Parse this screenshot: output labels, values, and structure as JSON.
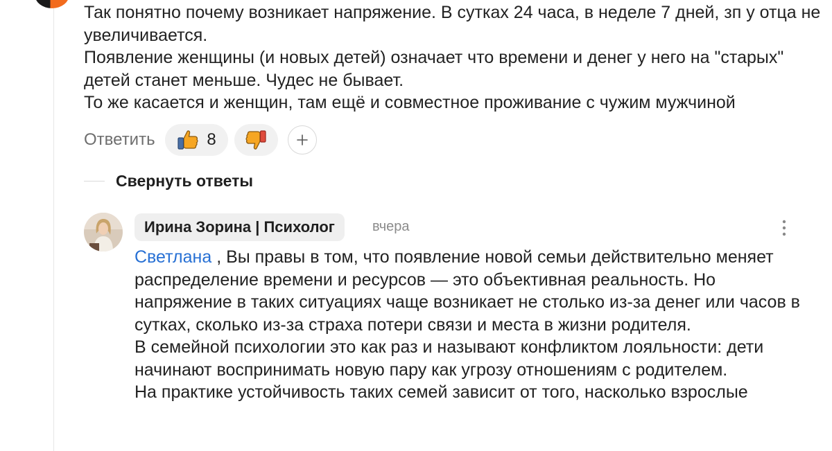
{
  "parent_comment": {
    "lines": [
      "Так понятно почему возникает напряжение. В сутках 24 часа, в неделе 7 дней, зп у отца не увеличивается.",
      "Появление женщины (и новых детей) означает что времени и денег у него на \"старых\" детей станет меньше. Чудес не бывает.",
      "То же касается и женщин, там ещё и совместное проживание с чужим мужчиной"
    ],
    "actions": {
      "reply_label": "Ответить",
      "like_count": "8",
      "like_icon": "thumbs-up-emoji",
      "dislike_icon": "thumbs-down-emoji",
      "plus_label": "+"
    }
  },
  "collapse_replies_label": "Свернуть ответы",
  "reply": {
    "author": "Ирина Зорина | Психолог",
    "timestamp": "вчера",
    "mention": "Светлана",
    "paragraphs": [
      ", Вы правы в том, что появление новой семьи действительно меняет распределение времени и ресурсов — это объективная реальность. Но напряжение в таких ситуациях чаще возникает не столько из-за денег или часов в сутках, сколько из-за страха потери связи и места в жизни родителя.",
      "В семейной психологии это как раз и называют конфликтом лояльности: дети начинают воспринимать новую пару как угрозу отношениям с родителем.",
      "На практике устойчивость таких семей зависит от того, насколько взрослые"
    ]
  },
  "colors": {
    "accent_link": "#2770d4",
    "pill_bg": "#f1f1f1",
    "emoji_yellow": "#f6a623"
  }
}
